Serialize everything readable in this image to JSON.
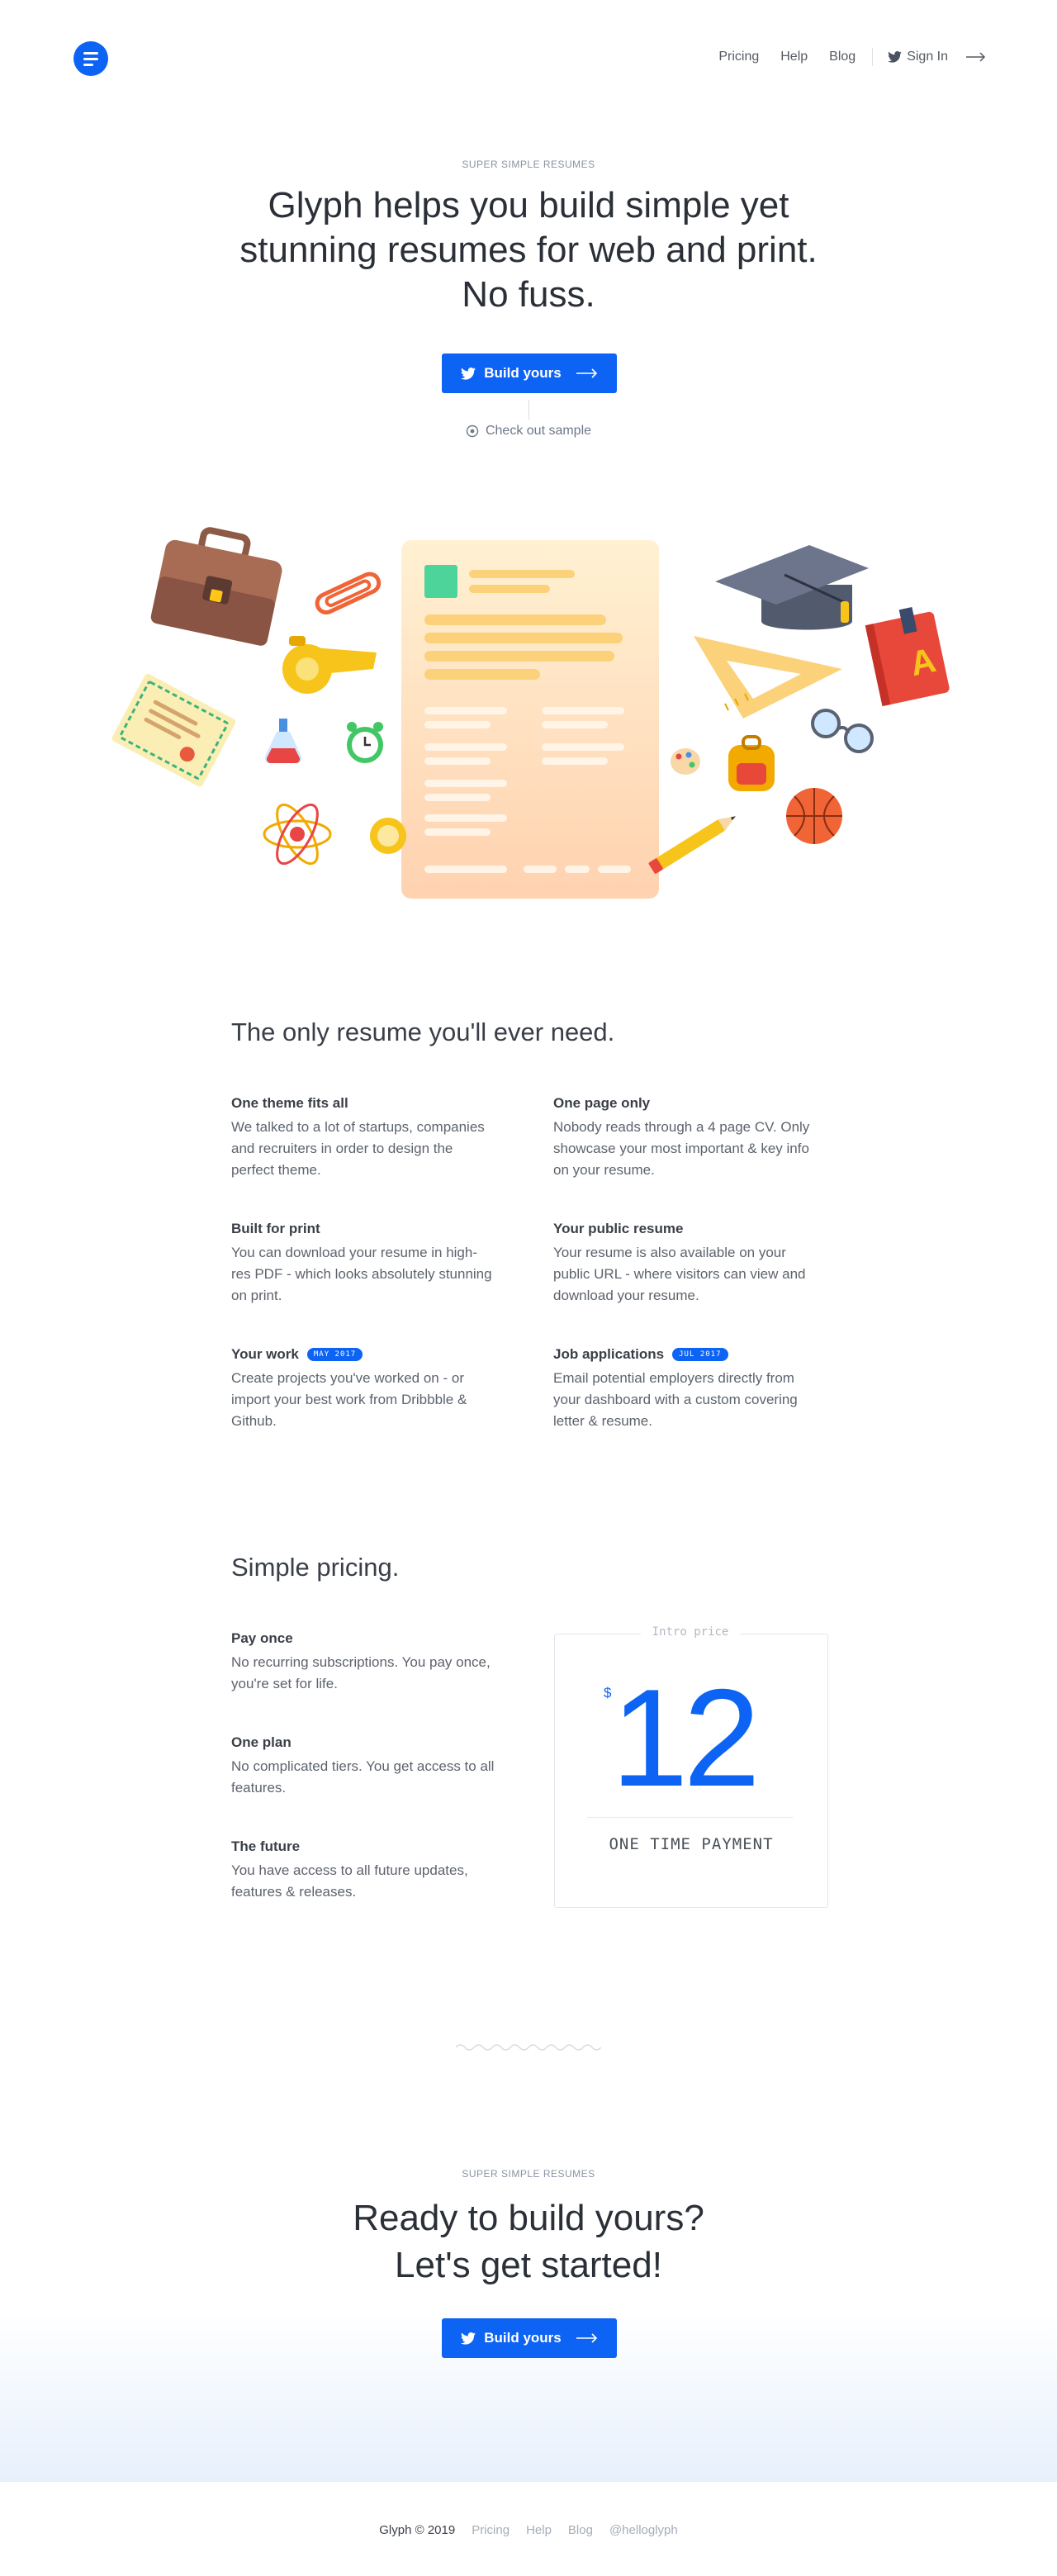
{
  "nav": {
    "pricing": "Pricing",
    "help": "Help",
    "blog": "Blog",
    "sign_in": "Sign In"
  },
  "hero": {
    "kicker": "SUPER SIMPLE RESUMES",
    "title": "Glyph helps you build simple yet stunning resumes for web and print. No fuss.",
    "cta": "Build yours",
    "sample_link": "Check out sample"
  },
  "features": {
    "title": "The only resume you'll ever need.",
    "items": [
      {
        "title": "One theme fits all",
        "text": "We talked to a lot of startups, companies and recruiters in order to design the perfect theme."
      },
      {
        "title": "One page only",
        "text": "Nobody reads through a 4 page CV. Only showcase your most important & key info on your resume."
      },
      {
        "title": "Built for print",
        "text": "You can download your resume in high-res PDF - which looks absolutely stunning on print."
      },
      {
        "title": "Your public resume",
        "text": "Your resume is also available on your public URL - where visitors can view and download your resume."
      },
      {
        "title": "Your work",
        "badge": "MAY 2017",
        "text": "Create projects you've worked on - or import your best work from Dribbble & Github."
      },
      {
        "title": "Job applications",
        "badge": "JUL 2017",
        "text": "Email potential employers directly from your dashboard with a custom covering letter & resume."
      }
    ]
  },
  "pricing": {
    "title": "Simple pricing.",
    "items": [
      {
        "title": "Pay once",
        "text": "No recurring subscriptions. You pay once, you're set for life."
      },
      {
        "title": "One plan",
        "text": "No complicated tiers. You get access to all features."
      },
      {
        "title": "The future",
        "text": "You have access to all future updates, features & releases."
      }
    ],
    "card": {
      "label": "Intro price",
      "currency": "$",
      "amount": "12",
      "caption": "ONE TIME PAYMENT"
    }
  },
  "cta": {
    "kicker": "SUPER SIMPLE RESUMES",
    "title_line1": "Ready to build yours?",
    "title_line2": "Let's get started!",
    "button": "Build yours"
  },
  "footer": {
    "copyright": "Glyph © 2019",
    "pricing": "Pricing",
    "help": "Help",
    "blog": "Blog",
    "twitter": "@helloglyph"
  },
  "colors": {
    "accent": "#0d63f3",
    "text": "#3a3f47",
    "muted": "#8a93a2",
    "cta_gradient": "#e7f0fc"
  }
}
